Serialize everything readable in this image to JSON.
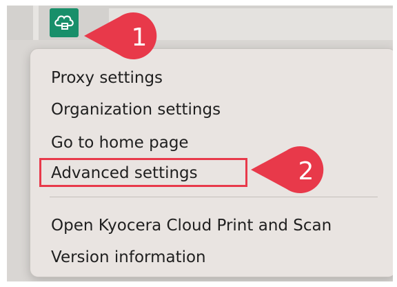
{
  "menu": {
    "items": [
      {
        "label": "Proxy settings"
      },
      {
        "label": "Organization settings"
      },
      {
        "label": "Go to home page"
      },
      {
        "label": "Advanced settings"
      },
      {
        "label": "Open Kyocera Cloud Print and Scan"
      },
      {
        "label": "Version information"
      }
    ]
  },
  "annotations": {
    "callout_1": "1",
    "callout_2": "2"
  },
  "colors": {
    "tray_icon": "#188f6a",
    "callout": "#e8394a",
    "highlight": "#e8394a"
  }
}
